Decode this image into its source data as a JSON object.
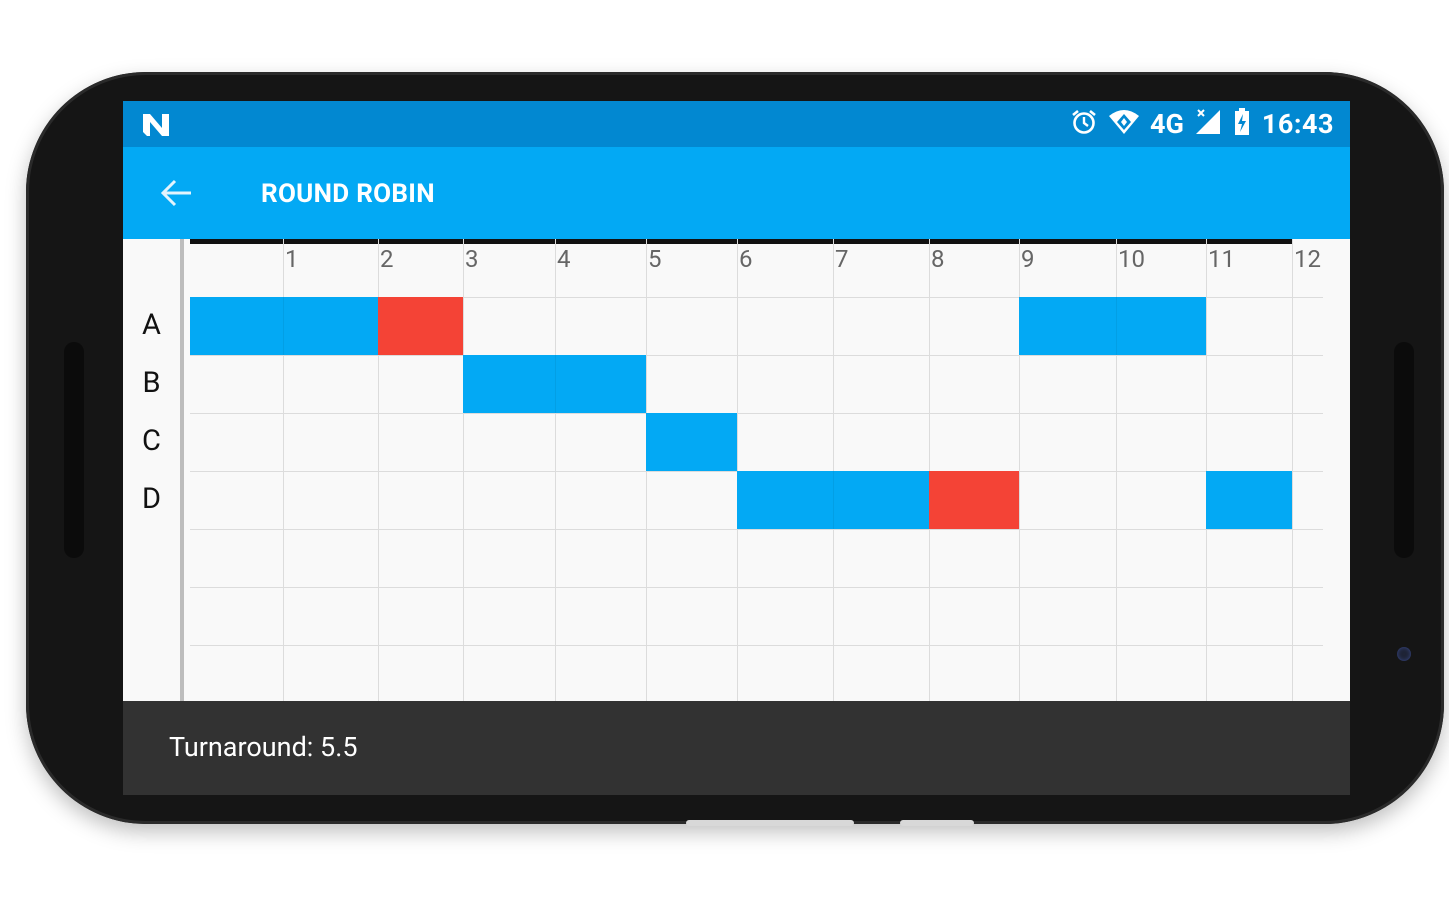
{
  "statusbar": {
    "left_icon": "n-logo-icon",
    "network": "4G",
    "time": "16:43"
  },
  "appbar": {
    "title": "ROUND ROBIN"
  },
  "gantt": {
    "tick_labels": [
      "1",
      "2",
      "3",
      "4",
      "5",
      "6",
      "7",
      "8",
      "9",
      "10",
      "11",
      "12"
    ],
    "rows": [
      "A",
      "B",
      "C",
      "D"
    ],
    "colors": {
      "running": "#03a9f4",
      "finished": "#f44336"
    },
    "blocks": [
      {
        "row": 0,
        "start": 0,
        "end": 2,
        "state": "running"
      },
      {
        "row": 0,
        "start": 2,
        "end": 3,
        "state": "finished"
      },
      {
        "row": 0,
        "start": 9,
        "end": 11,
        "state": "running"
      },
      {
        "row": 1,
        "start": 3,
        "end": 5,
        "state": "running"
      },
      {
        "row": 2,
        "start": 5,
        "end": 6,
        "state": "running"
      },
      {
        "row": 3,
        "start": 6,
        "end": 8,
        "state": "running"
      },
      {
        "row": 3,
        "start": 8,
        "end": 9,
        "state": "finished"
      },
      {
        "row": 3,
        "start": 11,
        "end": 12,
        "state": "running"
      }
    ]
  },
  "footer": {
    "text": "Turnaround: 5.5"
  }
}
